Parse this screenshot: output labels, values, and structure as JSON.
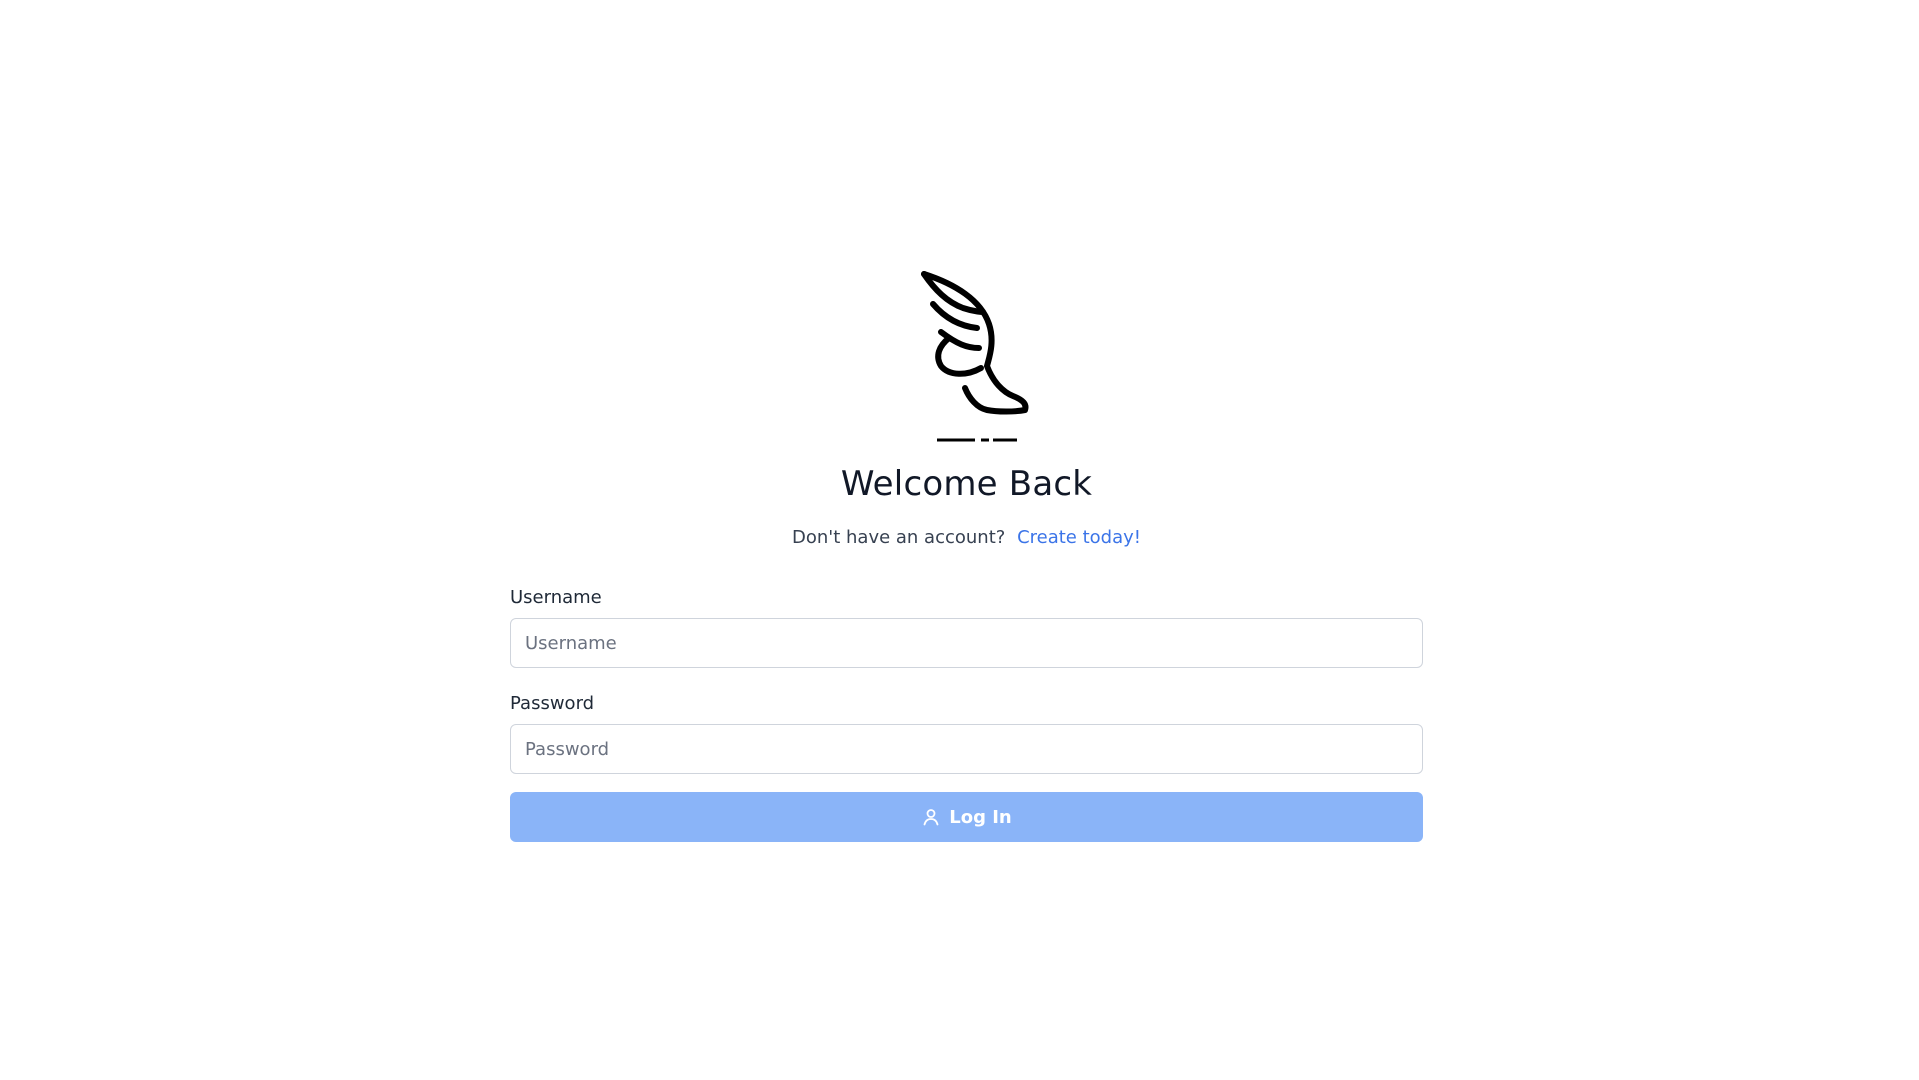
{
  "page": {
    "title": "Welcome Back"
  },
  "logo": {
    "name": "winged-shoe-logo"
  },
  "signup": {
    "prompt": "Don't have an account?",
    "link_label": "Create today!"
  },
  "form": {
    "username": {
      "label": "Username",
      "placeholder": "Username",
      "value": ""
    },
    "password": {
      "label": "Password",
      "placeholder": "Password",
      "value": ""
    },
    "submit": {
      "label": "Log In",
      "icon": "user-icon"
    }
  },
  "colors": {
    "accent": "#3b74e8",
    "button_bg": "#8ab4f8",
    "text": "#111827"
  }
}
